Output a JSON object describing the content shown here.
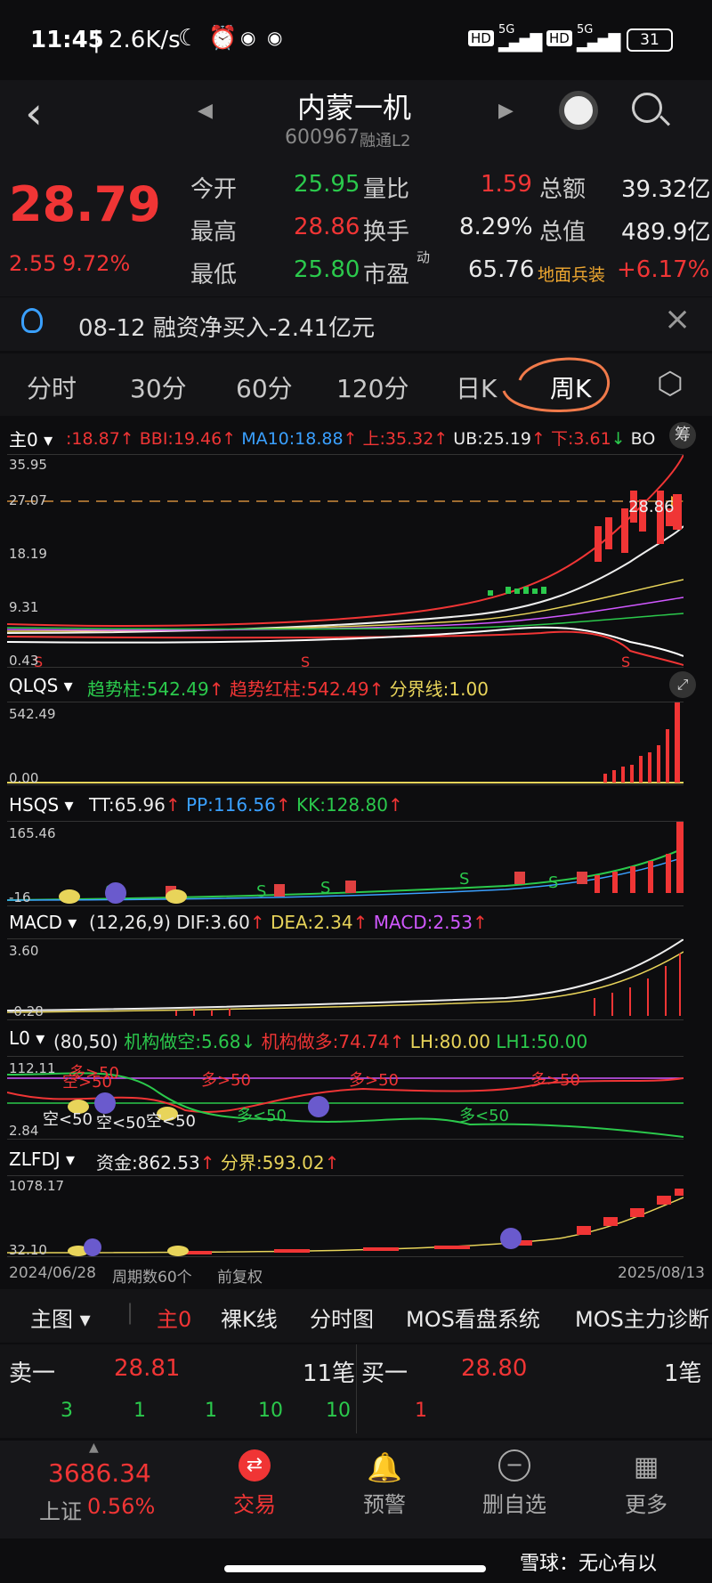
{
  "status": {
    "time": "11:45",
    "speed": "2.6K/s",
    "net1": "HD",
    "sig1": "5G",
    "net2": "HD",
    "sig2": "5G",
    "battery": "31"
  },
  "header": {
    "title": "内蒙一机",
    "code": "600967",
    "badges": "融通L2"
  },
  "quote": {
    "price": "28.79",
    "change": "2.55",
    "change_pct": "9.72%",
    "rows": [
      {
        "l1": "今开",
        "v1": "25.95",
        "l2": "量比",
        "v2": "1.59",
        "l3": "总额",
        "v3": "39.32亿"
      },
      {
        "l1": "最高",
        "v1": "28.86",
        "l2": "换手",
        "v2": "8.29%",
        "l3": "总值",
        "v3": "489.9亿"
      },
      {
        "l1": "最低",
        "v1": "25.80",
        "l2": "市盈",
        "v2": "65.76",
        "l3": "地面兵装",
        "v3": "+6.17%"
      }
    ],
    "pe_sup": "动"
  },
  "notice": {
    "text": "08-12 融资净买入-2.41亿元"
  },
  "tabs": [
    "分时",
    "30分",
    "60分",
    "120分",
    "日K",
    "周K"
  ],
  "main_ind": {
    "name": "主0",
    "vals": [
      {
        "t": ":18.87",
        "c": "red"
      },
      {
        "t": "↑",
        "c": "red"
      },
      {
        "t": " BBI:19.46",
        "c": "red"
      },
      {
        "t": "↑",
        "c": "red"
      },
      {
        "t": " MA10:18.88",
        "c": "blu"
      },
      {
        "t": "↑",
        "c": "red"
      },
      {
        "t": " 上:35.32",
        "c": "red"
      },
      {
        "t": "↑",
        "c": "red"
      },
      {
        "t": " UB:25.19",
        "c": "white"
      },
      {
        "t": "↑",
        "c": "red"
      },
      {
        "t": " 下:3.61",
        "c": "red"
      },
      {
        "t": "↓",
        "c": "green"
      },
      {
        "t": " BO",
        "c": "white"
      }
    ],
    "chip": "筹",
    "scales": [
      "35.95",
      "27.07",
      "18.19",
      "9.31",
      "0.43"
    ],
    "last": "28.86"
  },
  "qlqs": {
    "name": "QLQS",
    "vals": [
      {
        "t": "趋势柱:542.49",
        "c": "green"
      },
      {
        "t": "↑",
        "c": "red"
      },
      {
        "t": " 趋势红柱:542.49",
        "c": "red"
      },
      {
        "t": "↑",
        "c": "red"
      },
      {
        "t": " 分界线:1.00",
        "c": "yel"
      }
    ],
    "scales": [
      "542.49",
      "0.00"
    ]
  },
  "hsqs": {
    "name": "HSQS",
    "vals": [
      {
        "t": "TT:65.96",
        "c": "white"
      },
      {
        "t": "↑",
        "c": "red"
      },
      {
        "t": " PP:116.56",
        "c": "blu"
      },
      {
        "t": "↑",
        "c": "red"
      },
      {
        "t": " KK:128.80",
        "c": "green"
      },
      {
        "t": "↑",
        "c": "red"
      }
    ],
    "scales": [
      "165.46",
      "-16"
    ]
  },
  "macd": {
    "name": "MACD",
    "vals": [
      {
        "t": "(12,26,9)",
        "c": "white"
      },
      {
        "t": " DIF:3.60",
        "c": "white"
      },
      {
        "t": "↑",
        "c": "red"
      },
      {
        "t": " DEA:2.34",
        "c": "yel"
      },
      {
        "t": "↑",
        "c": "red"
      },
      {
        "t": " MACD:2.53",
        "c": "pur"
      },
      {
        "t": "↑",
        "c": "red"
      }
    ],
    "scales": [
      "3.60",
      "-0.28"
    ]
  },
  "l0": {
    "name": "L0",
    "vals": [
      {
        "t": "(80,50)",
        "c": "white"
      },
      {
        "t": " 机构做空:5.68",
        "c": "green"
      },
      {
        "t": "↓",
        "c": "green"
      },
      {
        "t": " 机构做多:74.74",
        "c": "red"
      },
      {
        "t": "↑",
        "c": "red"
      },
      {
        "t": " LH:80.00",
        "c": "yel"
      },
      {
        "t": " LH1:50.00",
        "c": "green"
      }
    ],
    "scales": [
      "112.11",
      "2.84"
    ],
    "labels": [
      "空>50",
      "多>50",
      "多>50",
      "多>50",
      "空<50",
      "空<50",
      "多<50",
      "多<50",
      "多>50",
      "空<50"
    ]
  },
  "zlfdj": {
    "name": "ZLFDJ",
    "vals": [
      {
        "t": "资金:862.53",
        "c": "white"
      },
      {
        "t": "↑",
        "c": "red"
      },
      {
        "t": " 分界:593.02",
        "c": "yel"
      },
      {
        "t": "↑",
        "c": "red"
      }
    ],
    "scales": [
      "1078.17",
      "32.10"
    ]
  },
  "footer_info": {
    "start": "2024/06/28",
    "periods": "周期数60个",
    "adjust": "前复权",
    "end": "2025/08/13"
  },
  "chart_bar": {
    "items": [
      "主图",
      "主0",
      "裸K线",
      "分时图",
      "MOS看盘系统",
      "MOS主力诊断"
    ]
  },
  "order": {
    "sell_label": "卖一",
    "sell_price": "28.81",
    "sell_count": "11笔",
    "buy_label": "买一",
    "buy_price": "28.80",
    "buy_count": "1笔",
    "sell_detail": [
      "3",
      "1",
      "1",
      "10",
      "10"
    ],
    "buy_detail": [
      "1"
    ]
  },
  "bottom": {
    "index_value": "3686.34",
    "index_name": "上证",
    "index_pct": "0.56%",
    "items": [
      "交易",
      "预警",
      "删自选",
      "更多"
    ]
  },
  "watermark": "雪球：无心有以",
  "colors": {
    "up": "#f03535",
    "down": "#2bc94c",
    "accent": "#f07a4a"
  }
}
